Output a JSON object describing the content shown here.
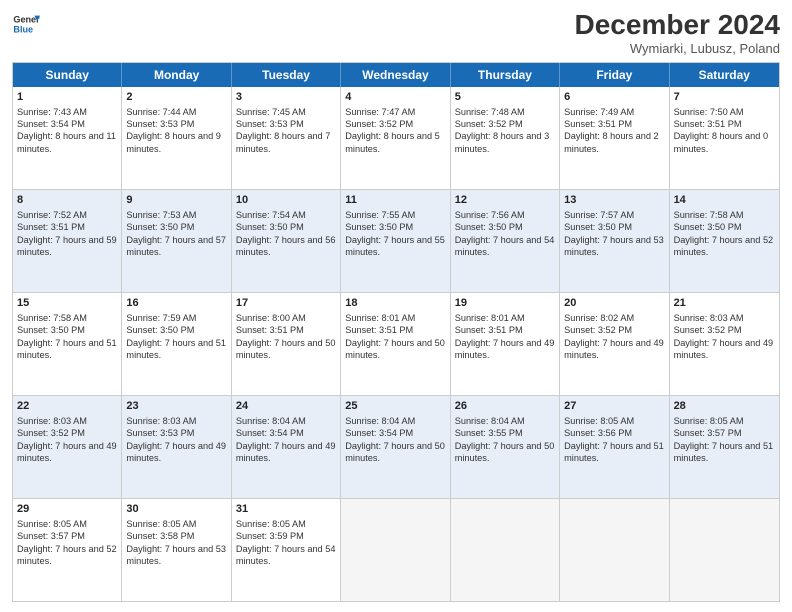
{
  "header": {
    "logo_line1": "General",
    "logo_line2": "Blue",
    "month": "December 2024",
    "location": "Wymiarki, Lubusz, Poland"
  },
  "days_of_week": [
    "Sunday",
    "Monday",
    "Tuesday",
    "Wednesday",
    "Thursday",
    "Friday",
    "Saturday"
  ],
  "weeks": [
    [
      {
        "day": "1",
        "sunrise": "7:43 AM",
        "sunset": "3:54 PM",
        "daylight": "8 hours and 11 minutes."
      },
      {
        "day": "2",
        "sunrise": "7:44 AM",
        "sunset": "3:53 PM",
        "daylight": "8 hours and 9 minutes."
      },
      {
        "day": "3",
        "sunrise": "7:45 AM",
        "sunset": "3:53 PM",
        "daylight": "8 hours and 7 minutes."
      },
      {
        "day": "4",
        "sunrise": "7:47 AM",
        "sunset": "3:52 PM",
        "daylight": "8 hours and 5 minutes."
      },
      {
        "day": "5",
        "sunrise": "7:48 AM",
        "sunset": "3:52 PM",
        "daylight": "8 hours and 3 minutes."
      },
      {
        "day": "6",
        "sunrise": "7:49 AM",
        "sunset": "3:51 PM",
        "daylight": "8 hours and 2 minutes."
      },
      {
        "day": "7",
        "sunrise": "7:50 AM",
        "sunset": "3:51 PM",
        "daylight": "8 hours and 0 minutes."
      }
    ],
    [
      {
        "day": "8",
        "sunrise": "7:52 AM",
        "sunset": "3:51 PM",
        "daylight": "7 hours and 59 minutes."
      },
      {
        "day": "9",
        "sunrise": "7:53 AM",
        "sunset": "3:50 PM",
        "daylight": "7 hours and 57 minutes."
      },
      {
        "day": "10",
        "sunrise": "7:54 AM",
        "sunset": "3:50 PM",
        "daylight": "7 hours and 56 minutes."
      },
      {
        "day": "11",
        "sunrise": "7:55 AM",
        "sunset": "3:50 PM",
        "daylight": "7 hours and 55 minutes."
      },
      {
        "day": "12",
        "sunrise": "7:56 AM",
        "sunset": "3:50 PM",
        "daylight": "7 hours and 54 minutes."
      },
      {
        "day": "13",
        "sunrise": "7:57 AM",
        "sunset": "3:50 PM",
        "daylight": "7 hours and 53 minutes."
      },
      {
        "day": "14",
        "sunrise": "7:58 AM",
        "sunset": "3:50 PM",
        "daylight": "7 hours and 52 minutes."
      }
    ],
    [
      {
        "day": "15",
        "sunrise": "7:58 AM",
        "sunset": "3:50 PM",
        "daylight": "7 hours and 51 minutes."
      },
      {
        "day": "16",
        "sunrise": "7:59 AM",
        "sunset": "3:50 PM",
        "daylight": "7 hours and 51 minutes."
      },
      {
        "day": "17",
        "sunrise": "8:00 AM",
        "sunset": "3:51 PM",
        "daylight": "7 hours and 50 minutes."
      },
      {
        "day": "18",
        "sunrise": "8:01 AM",
        "sunset": "3:51 PM",
        "daylight": "7 hours and 50 minutes."
      },
      {
        "day": "19",
        "sunrise": "8:01 AM",
        "sunset": "3:51 PM",
        "daylight": "7 hours and 49 minutes."
      },
      {
        "day": "20",
        "sunrise": "8:02 AM",
        "sunset": "3:52 PM",
        "daylight": "7 hours and 49 minutes."
      },
      {
        "day": "21",
        "sunrise": "8:03 AM",
        "sunset": "3:52 PM",
        "daylight": "7 hours and 49 minutes."
      }
    ],
    [
      {
        "day": "22",
        "sunrise": "8:03 AM",
        "sunset": "3:52 PM",
        "daylight": "7 hours and 49 minutes."
      },
      {
        "day": "23",
        "sunrise": "8:03 AM",
        "sunset": "3:53 PM",
        "daylight": "7 hours and 49 minutes."
      },
      {
        "day": "24",
        "sunrise": "8:04 AM",
        "sunset": "3:54 PM",
        "daylight": "7 hours and 49 minutes."
      },
      {
        "day": "25",
        "sunrise": "8:04 AM",
        "sunset": "3:54 PM",
        "daylight": "7 hours and 50 minutes."
      },
      {
        "day": "26",
        "sunrise": "8:04 AM",
        "sunset": "3:55 PM",
        "daylight": "7 hours and 50 minutes."
      },
      {
        "day": "27",
        "sunrise": "8:05 AM",
        "sunset": "3:56 PM",
        "daylight": "7 hours and 51 minutes."
      },
      {
        "day": "28",
        "sunrise": "8:05 AM",
        "sunset": "3:57 PM",
        "daylight": "7 hours and 51 minutes."
      }
    ],
    [
      {
        "day": "29",
        "sunrise": "8:05 AM",
        "sunset": "3:57 PM",
        "daylight": "7 hours and 52 minutes."
      },
      {
        "day": "30",
        "sunrise": "8:05 AM",
        "sunset": "3:58 PM",
        "daylight": "7 hours and 53 minutes."
      },
      {
        "day": "31",
        "sunrise": "8:05 AM",
        "sunset": "3:59 PM",
        "daylight": "7 hours and 54 minutes."
      },
      null,
      null,
      null,
      null
    ]
  ]
}
